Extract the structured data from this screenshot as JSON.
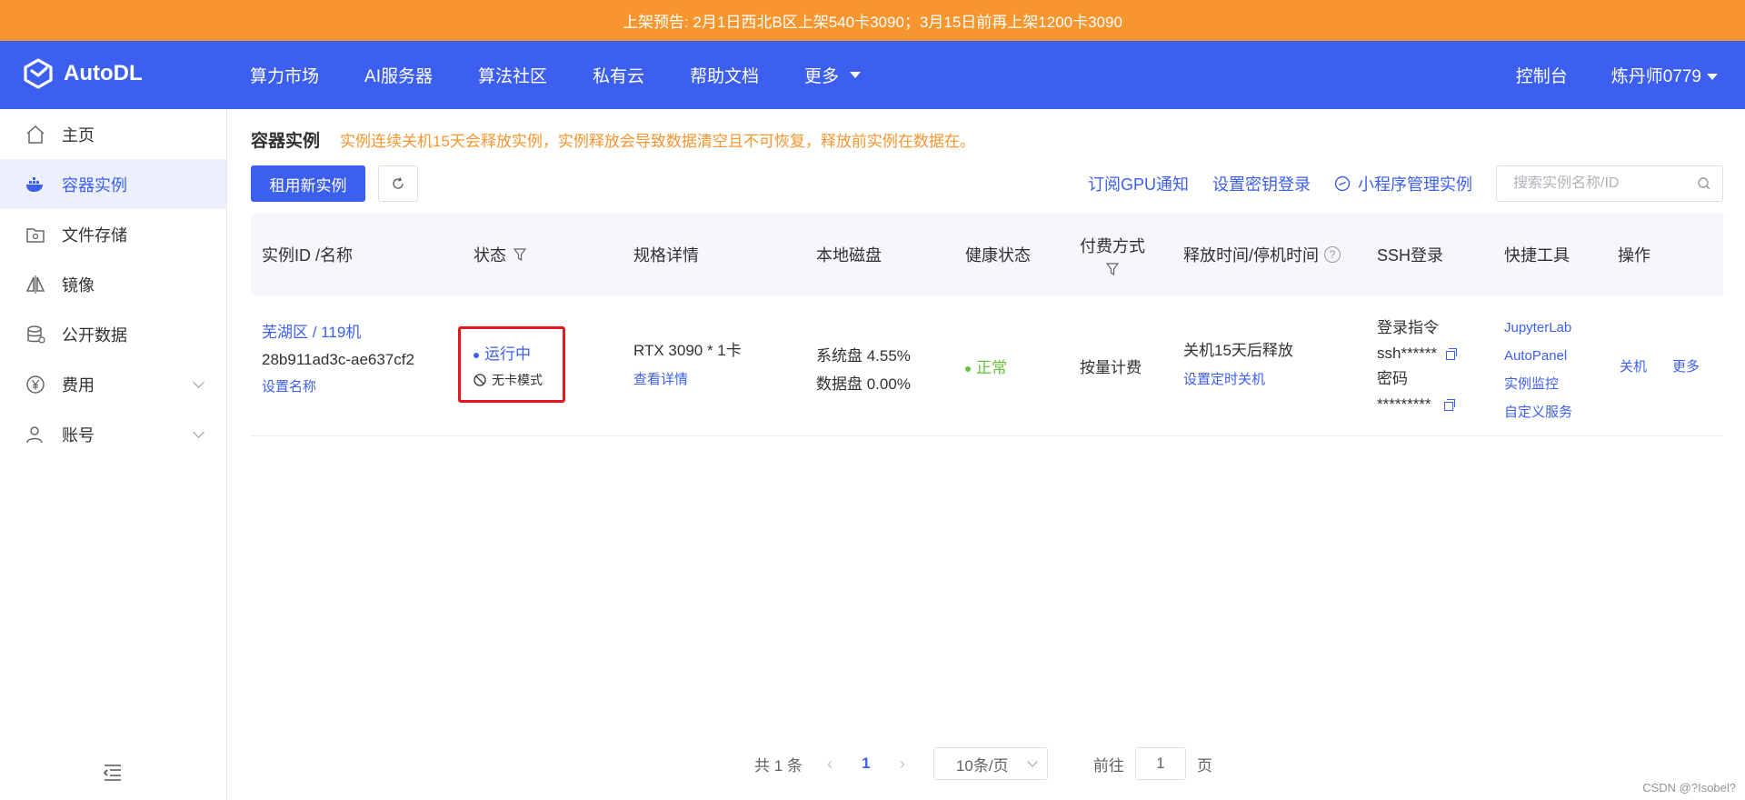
{
  "banner": {
    "text": "上架预告: 2月1日西北B区上架540卡3090；3月15日前再上架1200卡3090"
  },
  "topnav": {
    "brand": "AutoDL",
    "links": [
      "算力市场",
      "AI服务器",
      "算法社区",
      "私有云",
      "帮助文档",
      "更多"
    ],
    "console": "控制台",
    "user": "炼丹师0779"
  },
  "sidebar": {
    "items": [
      {
        "label": "主页",
        "icon": "home-icon"
      },
      {
        "label": "容器实例",
        "icon": "docker-icon",
        "active": true
      },
      {
        "label": "文件存储",
        "icon": "storage-icon"
      },
      {
        "label": "镜像",
        "icon": "mirror-icon"
      },
      {
        "label": "公开数据",
        "icon": "database-icon"
      },
      {
        "label": "费用",
        "icon": "yen-icon",
        "expandable": true
      },
      {
        "label": "账号",
        "icon": "user-icon",
        "expandable": true
      }
    ]
  },
  "main": {
    "title": "容器实例",
    "warning": "实例连续关机15天会释放实例，实例释放会导致数据清空且不可恢复，释放前实例在数据在。",
    "new_button": "租用新实例",
    "links": {
      "subscribe": "订阅GPU通知",
      "key_login": "设置密钥登录",
      "mini_program": "小程序管理实例"
    },
    "search_placeholder": "搜索实例名称/ID"
  },
  "table": {
    "headers": {
      "id": "实例ID /名称",
      "status": "状态",
      "spec": "规格详情",
      "disk": "本地磁盘",
      "health": "健康状态",
      "billing": "付费方式",
      "release": "释放时间/停机时间",
      "ssh": "SSH登录",
      "tools": "快捷工具",
      "ops": "操作"
    },
    "row": {
      "region": "芜湖区 / 119机",
      "instance_id": "28b911ad3c-ae637cf2",
      "set_name": "设置名称",
      "status": "运行中",
      "mode": "无卡模式",
      "spec": "RTX 3090 * 1卡",
      "spec_detail": "查看详情",
      "sys_disk": "系统盘 4.55%",
      "data_disk": "数据盘 0.00%",
      "health": "正常",
      "billing": "按量计费",
      "release": "关机15天后释放",
      "set_timer": "设置定时关机",
      "ssh_cmd_label": "登录指令",
      "ssh_cmd": "ssh******",
      "pwd_label": "密码",
      "pwd": "*********",
      "tools": [
        "JupyterLab",
        "AutoPanel",
        "实例监控",
        "自定义服务"
      ],
      "op_shutdown": "关机",
      "op_more": "更多"
    }
  },
  "pager": {
    "total": "共 1 条",
    "current": "1",
    "size": "10条/页",
    "goto": "前往",
    "goto_value": "1",
    "page_unit": "页"
  },
  "watermark": "CSDN @?Isobel?",
  "colors": {
    "primary": "#3c5ff0",
    "banner": "#f7952f",
    "health": "#67c23a",
    "highlight": "#e8161c"
  }
}
